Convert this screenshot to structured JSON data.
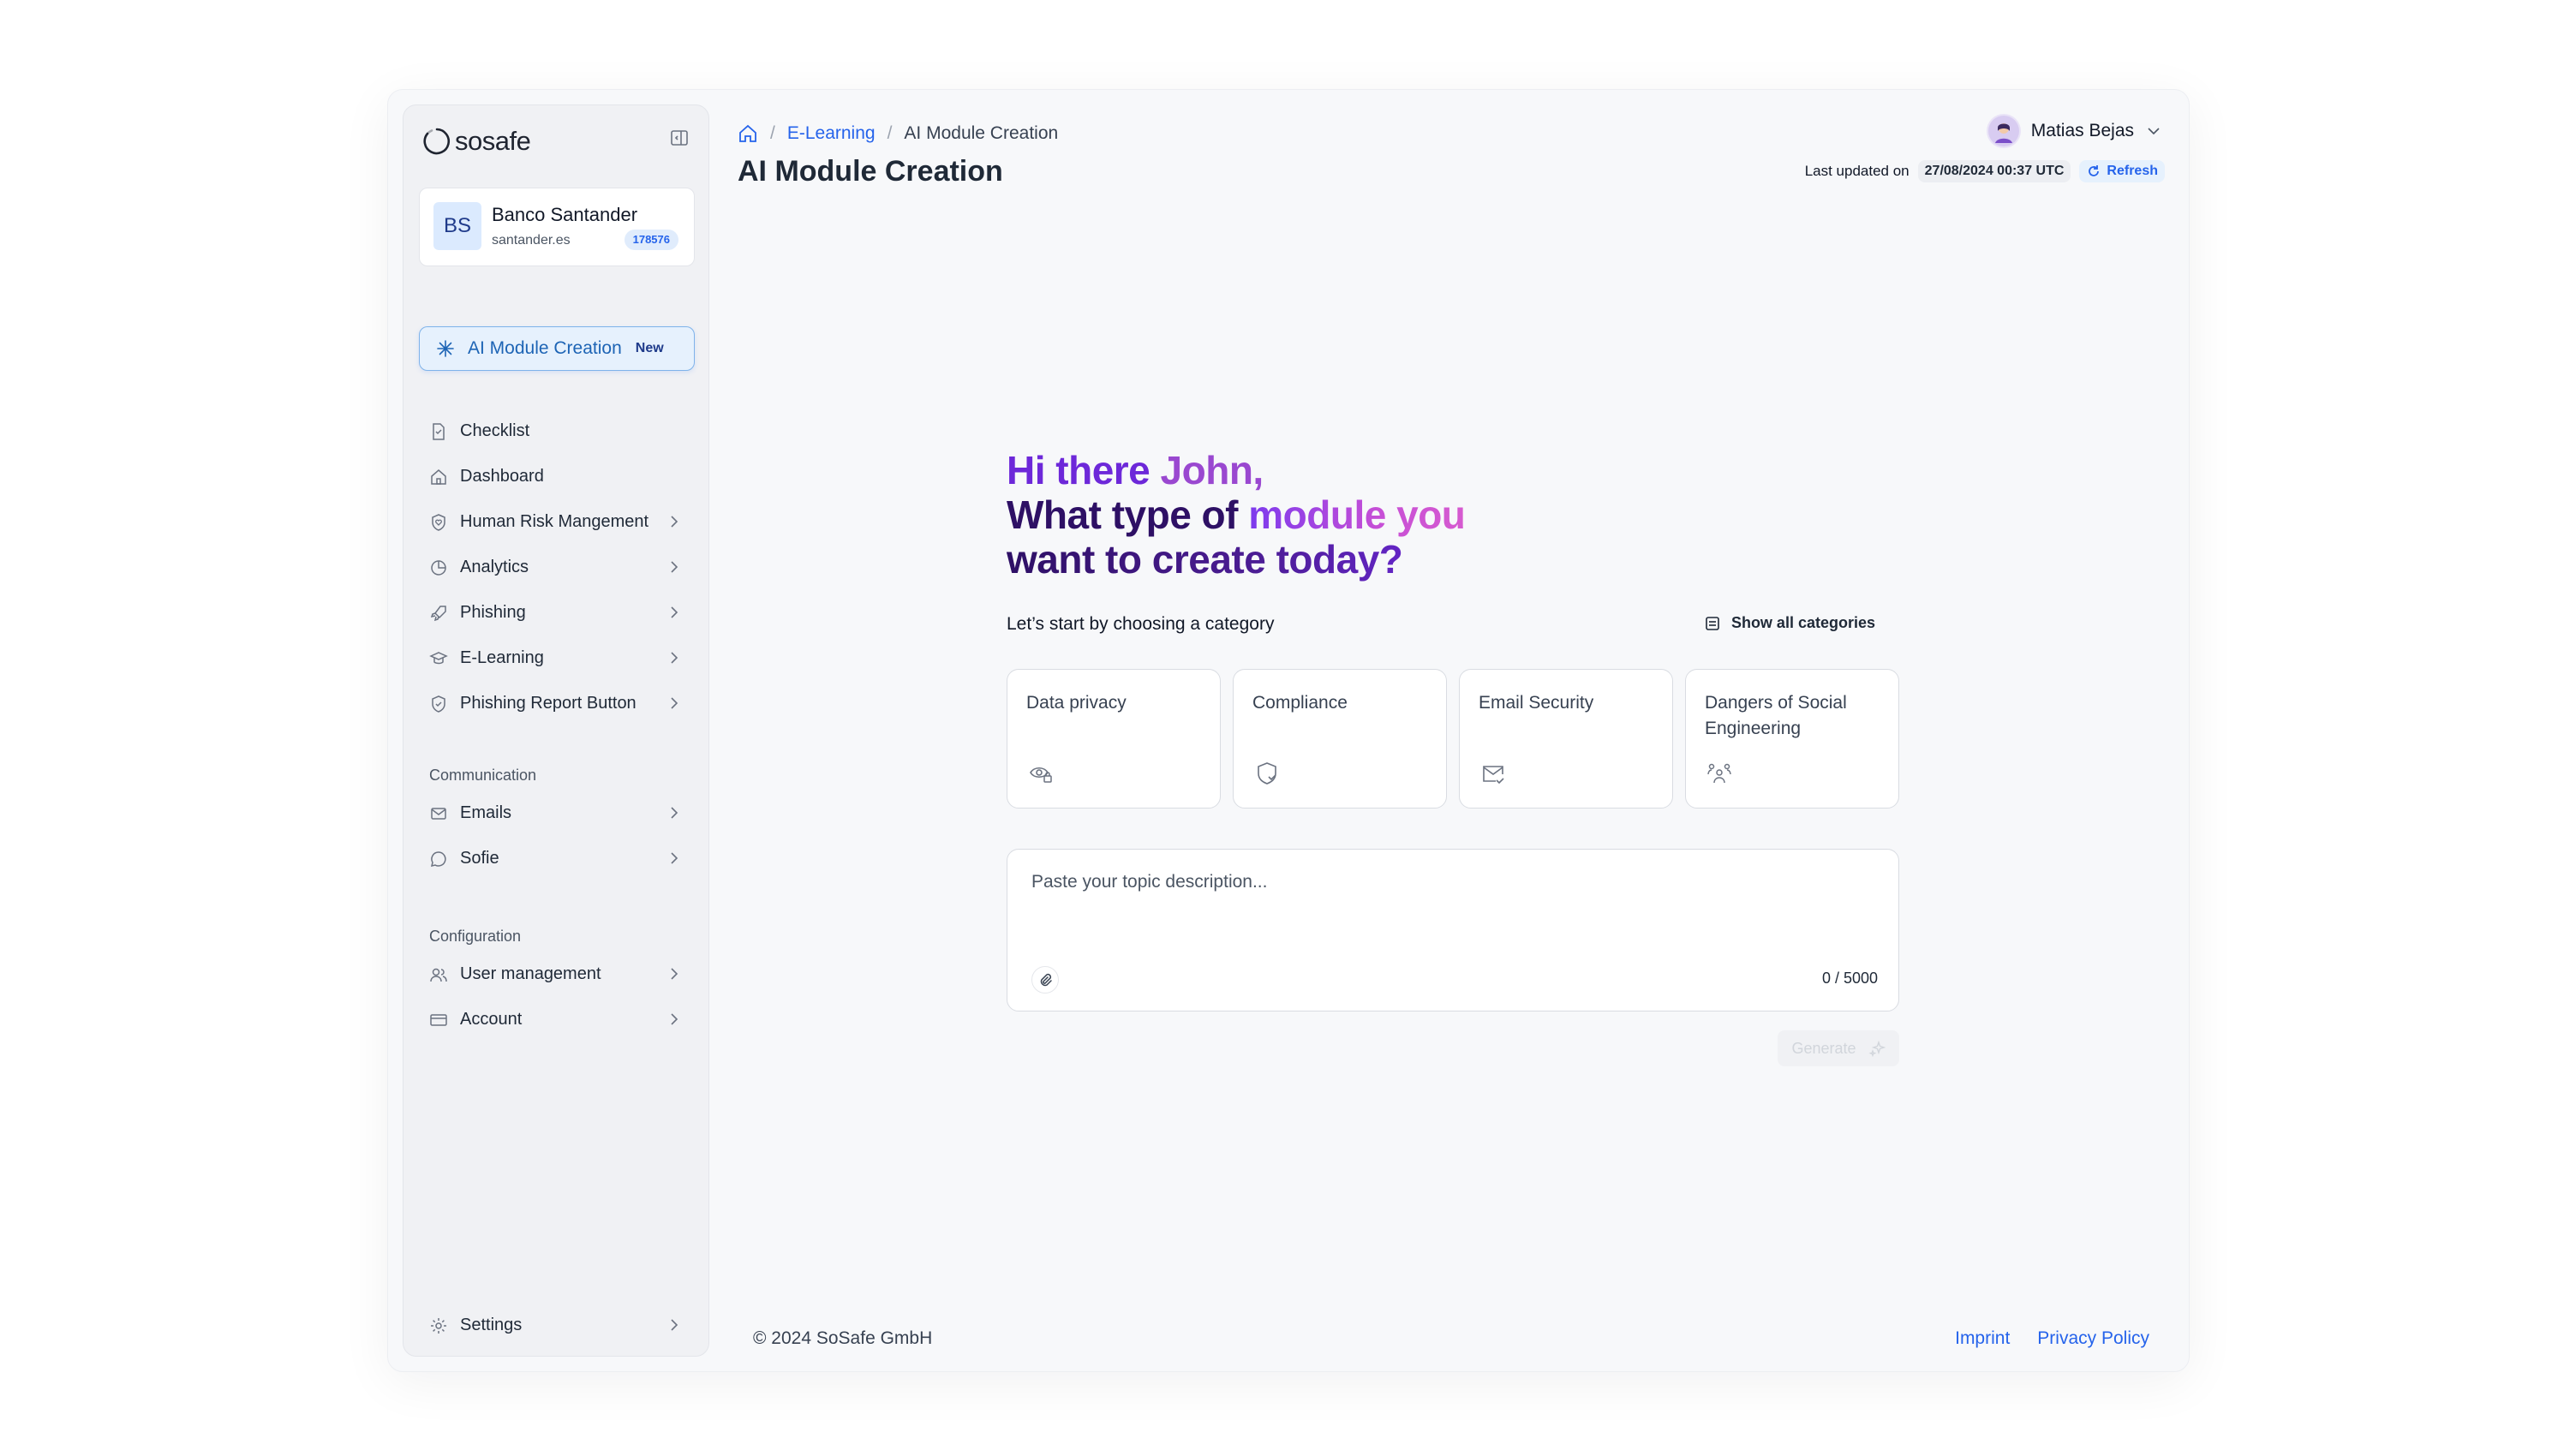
{
  "brand": {
    "name": "sosafe"
  },
  "organization": {
    "initials": "BS",
    "name": "Banco Santander",
    "domain": "santander.es",
    "id": "178576"
  },
  "ai_module": {
    "label": "AI Module Creation",
    "badge": "New"
  },
  "nav": {
    "main": [
      {
        "label": "Checklist",
        "icon": "document-icon",
        "chevron": false
      },
      {
        "label": "Dashboard",
        "icon": "home-icon",
        "chevron": false
      },
      {
        "label": "Human Risk Mangement",
        "icon": "shield-heart-icon",
        "chevron": true
      },
      {
        "label": "Analytics",
        "icon": "pie-chart-icon",
        "chevron": true
      },
      {
        "label": "Phishing",
        "icon": "rocket-icon",
        "chevron": true
      },
      {
        "label": "E-Learning",
        "icon": "graduation-cap-icon",
        "chevron": true
      },
      {
        "label": "Phishing Report Button",
        "icon": "shield-check-icon",
        "chevron": true
      }
    ],
    "communication_label": "Communication",
    "communication": [
      {
        "label": "Emails",
        "icon": "mail-icon",
        "chevron": true
      },
      {
        "label": "Sofie",
        "icon": "chat-bubble-icon",
        "chevron": true
      }
    ],
    "configuration_label": "Configuration",
    "configuration": [
      {
        "label": "User management",
        "icon": "users-icon",
        "chevron": true
      },
      {
        "label": "Account",
        "icon": "credit-card-icon",
        "chevron": true
      }
    ],
    "settings": {
      "label": "Settings",
      "icon": "gear-icon",
      "chevron": true
    }
  },
  "breadcrumb": {
    "home_icon": "home-icon",
    "parent": "E-Learning",
    "current": "AI Module Creation",
    "separator": "/"
  },
  "page": {
    "title": "AI Module Creation"
  },
  "user": {
    "name": "Matias Bejas"
  },
  "last_updated": {
    "label": "Last updated on",
    "timestamp": "27/08/2024 00:37 UTC",
    "refresh": "Refresh"
  },
  "greeting": {
    "hi": "Hi there ",
    "name": "John,",
    "line2_a": "What type of ",
    "line2_b": "module you",
    "line3": "want to create today?"
  },
  "categories": {
    "prompt": "Let’s start by choosing a category",
    "show_all": "Show all categories",
    "items": [
      {
        "label": "Data privacy",
        "icon": "eye-lock-icon"
      },
      {
        "label": "Compliance",
        "icon": "shield-check-icon"
      },
      {
        "label": "Email Security",
        "icon": "mail-check-icon"
      },
      {
        "label": "Dangers of Social Engineering",
        "icon": "people-group-icon"
      }
    ]
  },
  "topic": {
    "placeholder": "Paste your topic description...",
    "counter": "0 / 5000"
  },
  "generate": {
    "label": "Generate"
  },
  "footer": {
    "copyright": "© 2024 SoSafe GmbH",
    "imprint": "Imprint",
    "privacy": "Privacy Policy"
  },
  "colors": {
    "accent_blue": "#2563eb",
    "purple_dark": "#2e1065",
    "purple": "#6d28d9",
    "pink": "#d65ad0",
    "sidebar_bg": "#f0f1f4"
  }
}
